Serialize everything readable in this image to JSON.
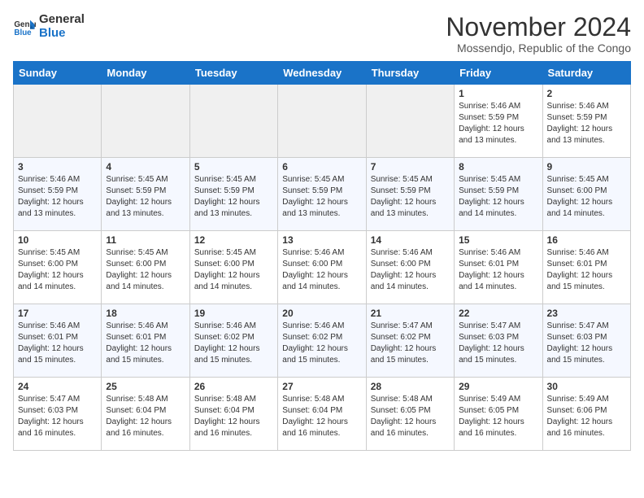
{
  "header": {
    "logo_line1": "General",
    "logo_line2": "Blue",
    "month_title": "November 2024",
    "location": "Mossendjo, Republic of the Congo"
  },
  "days_of_week": [
    "Sunday",
    "Monday",
    "Tuesday",
    "Wednesday",
    "Thursday",
    "Friday",
    "Saturday"
  ],
  "weeks": [
    [
      {
        "day": "",
        "empty": true
      },
      {
        "day": "",
        "empty": true
      },
      {
        "day": "",
        "empty": true
      },
      {
        "day": "",
        "empty": true
      },
      {
        "day": "",
        "empty": true
      },
      {
        "day": "1",
        "sunrise": "5:46 AM",
        "sunset": "5:59 PM",
        "daylight": "12 hours and 13 minutes."
      },
      {
        "day": "2",
        "sunrise": "5:46 AM",
        "sunset": "5:59 PM",
        "daylight": "12 hours and 13 minutes."
      }
    ],
    [
      {
        "day": "3",
        "sunrise": "5:46 AM",
        "sunset": "5:59 PM",
        "daylight": "12 hours and 13 minutes."
      },
      {
        "day": "4",
        "sunrise": "5:45 AM",
        "sunset": "5:59 PM",
        "daylight": "12 hours and 13 minutes."
      },
      {
        "day": "5",
        "sunrise": "5:45 AM",
        "sunset": "5:59 PM",
        "daylight": "12 hours and 13 minutes."
      },
      {
        "day": "6",
        "sunrise": "5:45 AM",
        "sunset": "5:59 PM",
        "daylight": "12 hours and 13 minutes."
      },
      {
        "day": "7",
        "sunrise": "5:45 AM",
        "sunset": "5:59 PM",
        "daylight": "12 hours and 13 minutes."
      },
      {
        "day": "8",
        "sunrise": "5:45 AM",
        "sunset": "5:59 PM",
        "daylight": "12 hours and 14 minutes."
      },
      {
        "day": "9",
        "sunrise": "5:45 AM",
        "sunset": "6:00 PM",
        "daylight": "12 hours and 14 minutes."
      }
    ],
    [
      {
        "day": "10",
        "sunrise": "5:45 AM",
        "sunset": "6:00 PM",
        "daylight": "12 hours and 14 minutes."
      },
      {
        "day": "11",
        "sunrise": "5:45 AM",
        "sunset": "6:00 PM",
        "daylight": "12 hours and 14 minutes."
      },
      {
        "day": "12",
        "sunrise": "5:45 AM",
        "sunset": "6:00 PM",
        "daylight": "12 hours and 14 minutes."
      },
      {
        "day": "13",
        "sunrise": "5:46 AM",
        "sunset": "6:00 PM",
        "daylight": "12 hours and 14 minutes."
      },
      {
        "day": "14",
        "sunrise": "5:46 AM",
        "sunset": "6:00 PM",
        "daylight": "12 hours and 14 minutes."
      },
      {
        "day": "15",
        "sunrise": "5:46 AM",
        "sunset": "6:01 PM",
        "daylight": "12 hours and 14 minutes."
      },
      {
        "day": "16",
        "sunrise": "5:46 AM",
        "sunset": "6:01 PM",
        "daylight": "12 hours and 15 minutes."
      }
    ],
    [
      {
        "day": "17",
        "sunrise": "5:46 AM",
        "sunset": "6:01 PM",
        "daylight": "12 hours and 15 minutes."
      },
      {
        "day": "18",
        "sunrise": "5:46 AM",
        "sunset": "6:01 PM",
        "daylight": "12 hours and 15 minutes."
      },
      {
        "day": "19",
        "sunrise": "5:46 AM",
        "sunset": "6:02 PM",
        "daylight": "12 hours and 15 minutes."
      },
      {
        "day": "20",
        "sunrise": "5:46 AM",
        "sunset": "6:02 PM",
        "daylight": "12 hours and 15 minutes."
      },
      {
        "day": "21",
        "sunrise": "5:47 AM",
        "sunset": "6:02 PM",
        "daylight": "12 hours and 15 minutes."
      },
      {
        "day": "22",
        "sunrise": "5:47 AM",
        "sunset": "6:03 PM",
        "daylight": "12 hours and 15 minutes."
      },
      {
        "day": "23",
        "sunrise": "5:47 AM",
        "sunset": "6:03 PM",
        "daylight": "12 hours and 15 minutes."
      }
    ],
    [
      {
        "day": "24",
        "sunrise": "5:47 AM",
        "sunset": "6:03 PM",
        "daylight": "12 hours and 16 minutes."
      },
      {
        "day": "25",
        "sunrise": "5:48 AM",
        "sunset": "6:04 PM",
        "daylight": "12 hours and 16 minutes."
      },
      {
        "day": "26",
        "sunrise": "5:48 AM",
        "sunset": "6:04 PM",
        "daylight": "12 hours and 16 minutes."
      },
      {
        "day": "27",
        "sunrise": "5:48 AM",
        "sunset": "6:04 PM",
        "daylight": "12 hours and 16 minutes."
      },
      {
        "day": "28",
        "sunrise": "5:48 AM",
        "sunset": "6:05 PM",
        "daylight": "12 hours and 16 minutes."
      },
      {
        "day": "29",
        "sunrise": "5:49 AM",
        "sunset": "6:05 PM",
        "daylight": "12 hours and 16 minutes."
      },
      {
        "day": "30",
        "sunrise": "5:49 AM",
        "sunset": "6:06 PM",
        "daylight": "12 hours and 16 minutes."
      }
    ]
  ],
  "labels": {
    "sunrise": "Sunrise:",
    "sunset": "Sunset:",
    "daylight": "Daylight:"
  }
}
